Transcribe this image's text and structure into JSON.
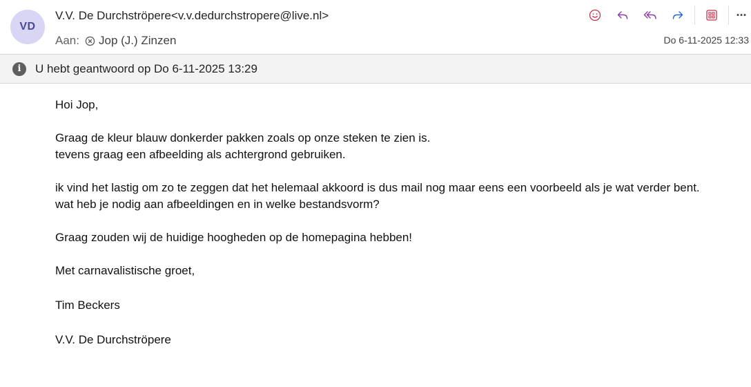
{
  "sender": {
    "initials": "VD",
    "display": "V.V. De Durchströpere<v.v.dedurchstropere@live.nl>"
  },
  "to": {
    "label": "Aan:",
    "recipient": "Jop (J.) Zinzen"
  },
  "date": "Do 6-11-2025 12:33",
  "toolbar": {
    "emoji_icon": "emoji-icon",
    "reply_icon": "reply-icon",
    "reply_all_icon": "reply-all-icon",
    "forward_icon": "forward-icon",
    "apps_icon": "apps-icon",
    "more_label": "···"
  },
  "info": {
    "icon": "i",
    "text": "U hebt geantwoord op Do 6-11-2025 13:29"
  },
  "body": {
    "greeting": "Hoi Jop,",
    "p1_l1": "Graag de kleur blauw donkerder pakken zoals op onze steken te zien is.",
    "p1_l2": "tevens graag een afbeelding als achtergrond gebruiken.",
    "p2_l1": "ik vind het lastig om zo te zeggen dat het helemaal akkoord is dus mail nog maar eens een voorbeeld als je wat verder bent.",
    "p2_l2": "wat heb je nodig aan afbeeldingen en in welke bestandsvorm?",
    "p3": "Graag zouden wij de huidige hoogheden op de homepagina hebben!",
    "closing": "Met carnavalistische groet,",
    "name": "Tim Beckers",
    "org": "V.V. De Durchströpere"
  }
}
